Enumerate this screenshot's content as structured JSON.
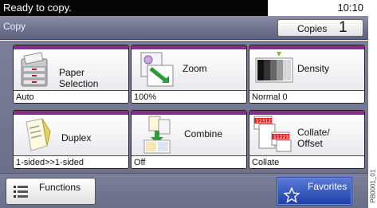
{
  "status": {
    "message": "Ready to copy.",
    "time": "10:10"
  },
  "header": {
    "title": "Copy",
    "copies_label": "Copies",
    "copies_value": "1"
  },
  "tiles": [
    {
      "label": "Paper\nSelection",
      "label_line1": "Paper",
      "label_line2": "Selection",
      "value": "Auto",
      "icon": "paper-selection-icon"
    },
    {
      "label": "Zoom",
      "value": "100%",
      "icon": "zoom-icon"
    },
    {
      "label": "Density",
      "value": "Normal 0",
      "icon": "density-icon"
    },
    {
      "label": "Duplex",
      "value": "1-sided>>1-sided",
      "icon": "duplex-icon"
    },
    {
      "label": "Combine",
      "value": "Off",
      "icon": "combine-icon"
    },
    {
      "label_line1": "Collate/",
      "label_line2": "Offset",
      "value": "Collate",
      "icon": "collate-offset-icon"
    }
  ],
  "bottom": {
    "functions_label": "Functions",
    "favorites_label": "Favorites"
  },
  "side_code": "PB0001_01",
  "colors": {
    "tile_accent": "#8a2c8c",
    "favorites": "#2447b3",
    "panel": "#6d718c"
  }
}
